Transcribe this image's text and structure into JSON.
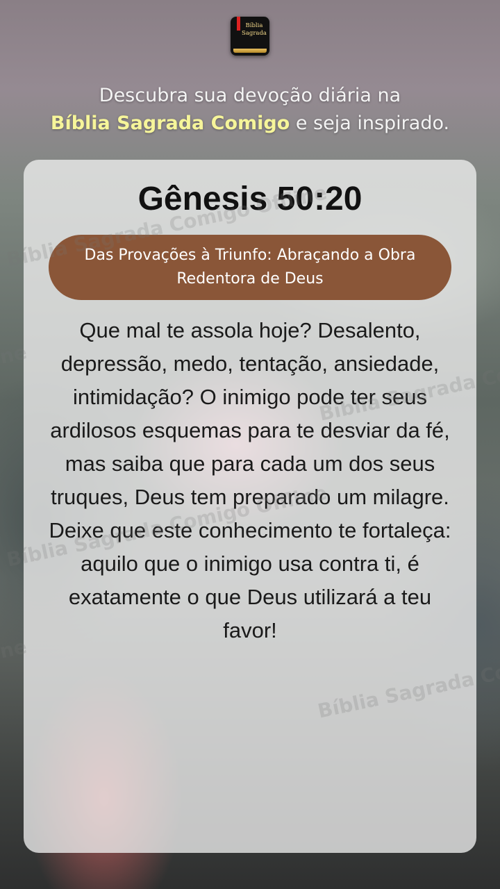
{
  "app": {
    "logo_text_line1": "Bíblia",
    "logo_text_line2": "Sagrada"
  },
  "header": {
    "tagline_part1": "Descubra sua devoção diária na ",
    "tagline_brand": "Bíblia Sagrada Comigo",
    "tagline_part2": " e seja inspirado."
  },
  "card": {
    "verse_reference": "Gênesis 50:20",
    "title": "Das Provações à Triunfo: Abraçando a Obra Redentora de Deus",
    "devotion_text": "Que mal te assola hoje? Desalento, depressão, medo, tentação, ansiedade, intimidação? O inimigo pode ter seus ardilosos esquemas para te desviar da fé, mas saiba que para cada um dos seus truques, Deus tem preparado um milagre. Deixe que este conhecimento te fortaleça: aquilo que o inimigo usa contra ti, é exatamente o que Deus utilizará a teu favor!"
  },
  "watermark": {
    "text": "Bíblia Sagrada Comigo Offline",
    "fragment": "ne"
  },
  "colors": {
    "brand_highlight": "#f6f59a",
    "title_pill": "#8a5638",
    "card_bg": "#eeeeee"
  }
}
